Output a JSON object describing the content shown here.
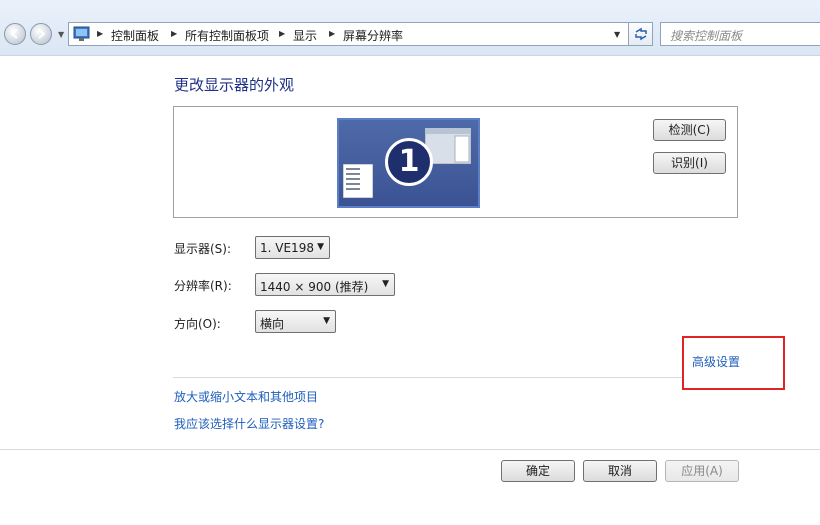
{
  "address_bar": {
    "crumbs": [
      "控制面板",
      "所有控制面板项",
      "显示",
      "屏幕分辨率"
    ],
    "search_placeholder": "搜索控制面板"
  },
  "main": {
    "title": "更改显示器的外观",
    "monitor_number": "1",
    "detect_button": "检测(C)",
    "identify_button": "识别(I)",
    "display_label": "显示器(S):",
    "display_value": "1. VE198",
    "resolution_label": "分辨率(R):",
    "resolution_value": "1440 × 900 (推荐)",
    "orientation_label": "方向(O):",
    "orientation_value": "横向",
    "advanced_link": "高级设置",
    "text_size_link": "放大或缩小文本和其他项目",
    "help_link": "我应该选择什么显示器设置?"
  },
  "footer": {
    "ok_button": "确定",
    "cancel_button": "取消",
    "apply_button": "应用(A)"
  },
  "colors": {
    "title": "#1e3287",
    "link": "#1e5ebc",
    "highlight": "#e02424"
  }
}
